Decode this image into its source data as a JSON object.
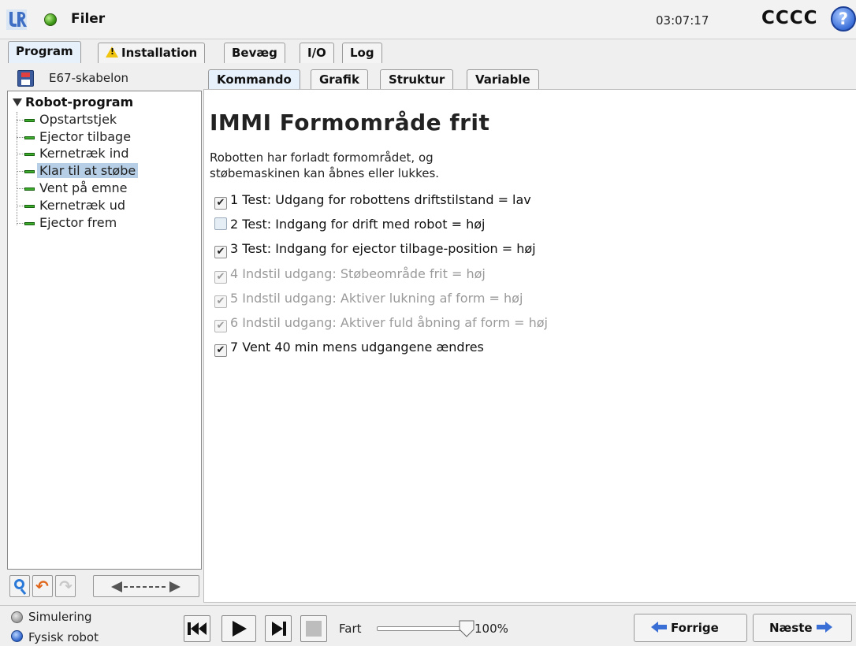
{
  "topbar": {
    "files_label": "Filer",
    "clock": "03:07:17",
    "robot_name": "CCCC",
    "help_symbol": "?"
  },
  "main_tabs": [
    {
      "label": "Program",
      "active": true
    },
    {
      "label": "Installation",
      "icon": "warning-icon"
    },
    {
      "label": "Bevæg"
    },
    {
      "label": "I/O"
    },
    {
      "label": "Log"
    }
  ],
  "left_panel": {
    "program_name": "E67-skabelon",
    "tree": {
      "root": "Robot-program",
      "items": [
        {
          "label": "Opstartstjek"
        },
        {
          "label": "Ejector tilbage"
        },
        {
          "label": "Kernetræk ind"
        },
        {
          "label": "Klar til at støbe",
          "selected": true
        },
        {
          "label": "Vent på emne"
        },
        {
          "label": "Kernetræk ud"
        },
        {
          "label": "Ejector frem"
        }
      ]
    }
  },
  "sub_tabs": [
    {
      "label": "Kommando",
      "active": true
    },
    {
      "label": "Grafik"
    },
    {
      "label": "Struktur"
    },
    {
      "label": "Variable"
    }
  ],
  "content": {
    "title": "IMMI Formområde frit",
    "description_line1": "Robotten har forladt formområdet, og",
    "description_line2": "støbemaskinen kan åbnes eller lukkes.",
    "checks": [
      {
        "label": "1 Test: Udgang for robottens driftstilstand = lav",
        "checked": true,
        "enabled": true
      },
      {
        "label": "2 Test: Indgang for drift med robot = høj",
        "checked": false,
        "enabled": true
      },
      {
        "label": "3 Test: Indgang for ejector tilbage-position = høj",
        "checked": true,
        "enabled": true
      },
      {
        "label": "4 Indstil udgang: Støbeområde frit = høj",
        "checked": true,
        "enabled": false
      },
      {
        "label": "5 Indstil udgang: Aktiver lukning af form = høj",
        "checked": true,
        "enabled": false
      },
      {
        "label": "6 Indstil udgang: Aktiver fuld åbning af form = høj",
        "checked": true,
        "enabled": false
      },
      {
        "label": "7 Vent 40 min mens udgangene ændres",
        "checked": true,
        "enabled": true
      }
    ]
  },
  "statusbar": {
    "simulation_label": "Simulering",
    "real_robot_label": "Fysisk robot",
    "speed_label": "Fart",
    "speed_value": "100%",
    "speed_fraction": 1.0,
    "prev_label": "Forrige",
    "next_label": "Næste"
  },
  "colors": {
    "accent_blue": "#3a6fd6",
    "tree_green": "#3dab2b",
    "selection": "#b6cfe6",
    "warning_yellow": "#f1c40f"
  }
}
